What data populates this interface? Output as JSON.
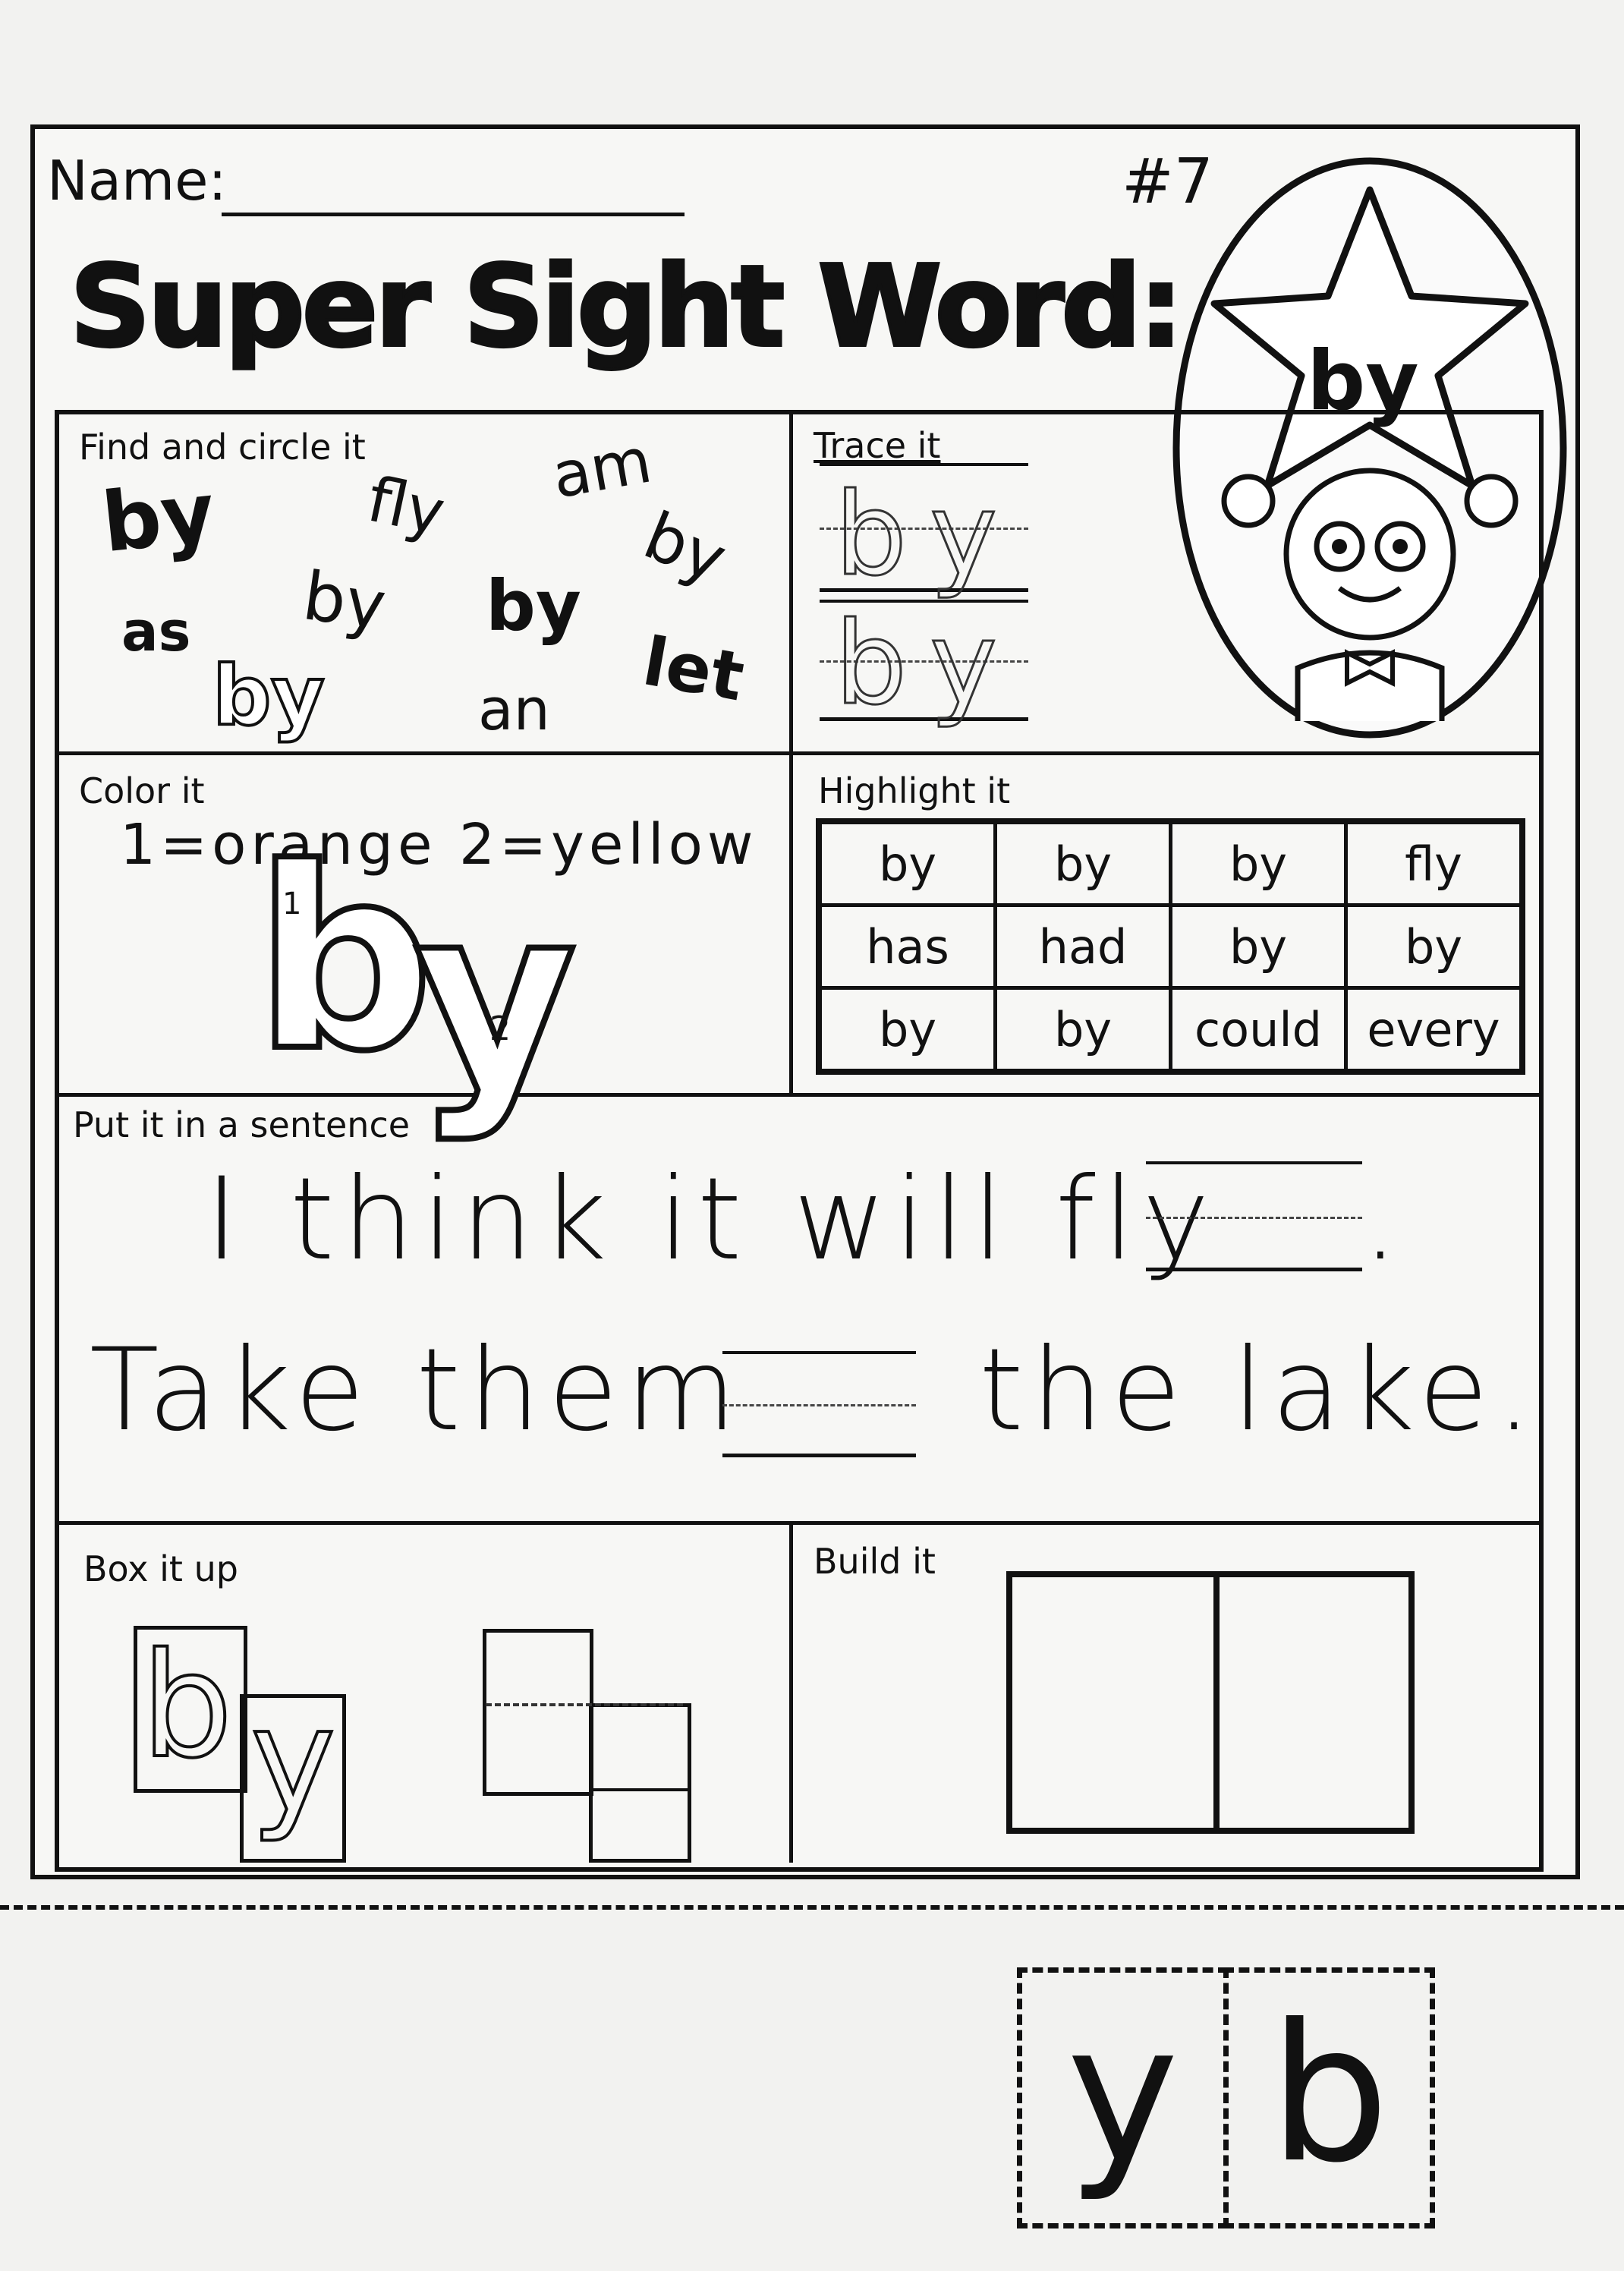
{
  "header": {
    "name_label": "Name:",
    "number": "#7",
    "title": "Super Sight Word:",
    "star_word": "by"
  },
  "find_circle": {
    "label": "Find and circle it",
    "words": [
      "by",
      "fly",
      "am",
      "by",
      "as",
      "by",
      "by",
      "let",
      "by",
      "an"
    ]
  },
  "trace": {
    "label": "Trace it",
    "lines": [
      "by",
      "by"
    ]
  },
  "color": {
    "label": "Color it",
    "key": "1=orange 2=yellow",
    "letters": [
      "b",
      "y"
    ],
    "numbers": [
      "1",
      "2"
    ]
  },
  "highlight": {
    "label": "Highlight it",
    "rows": [
      [
        "by",
        "by",
        "by",
        "fly"
      ],
      [
        "has",
        "had",
        "by",
        "by"
      ],
      [
        "by",
        "by",
        "could",
        "every"
      ]
    ]
  },
  "sentence": {
    "label": "Put it in a sentence",
    "s1_start": "I think it will fly",
    "s1_end": ".",
    "s2_start": "Take them",
    "s2_end": "the lake."
  },
  "boxit": {
    "label": "Box it up",
    "letters": [
      "b",
      "y"
    ]
  },
  "build": {
    "label": "Build it"
  },
  "cutout": {
    "tiles": [
      "y",
      "b"
    ]
  }
}
